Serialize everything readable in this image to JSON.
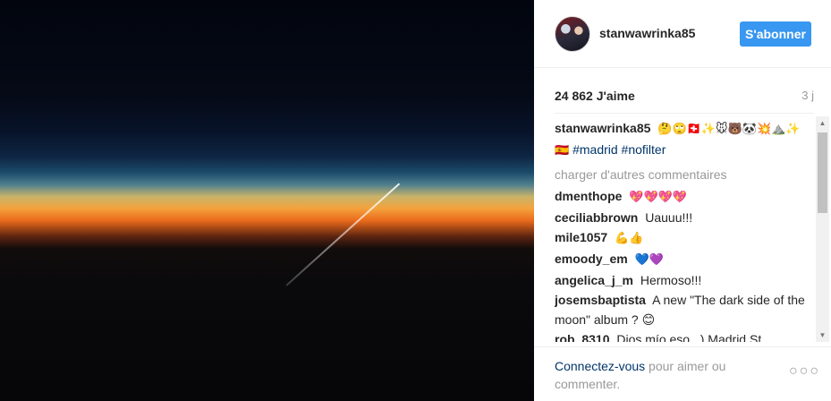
{
  "post": {
    "username": "stanwawrinka85",
    "follow_label": "S'abonner",
    "likes": "24 862 J'aime",
    "time": "3 j",
    "caption": {
      "username": "stanwawrinka85",
      "emoji": "🤔🙄🇨🇭✨🐭🐻🐼💥⛰️✨",
      "es": "🇪🇸",
      "tags": "#madrid #nofilter"
    },
    "load_more": "charger d'autres commentaires",
    "comments": [
      {
        "user": "dmenthope",
        "text": "💖💖💖💖"
      },
      {
        "user": "ceciliabbrown",
        "text": "Uauuu!!!"
      },
      {
        "user": "mile1057",
        "text": "💪👍"
      },
      {
        "user": "emoody_em",
        "text": "💙💜"
      },
      {
        "user": "angelica_j_m",
        "text": "Hermoso!!!"
      },
      {
        "user": "josemsbaptista",
        "text": "A new \"The dark side of the moon\" album ? 😊"
      },
      {
        "user": "rob_8310",
        "text": "Dios mío eso.. ) Madrid St..."
      }
    ],
    "footer": {
      "login_link": "Connectez-vous",
      "rest": " pour aimer ou commenter."
    },
    "more_icon": "ellipsis-icon"
  }
}
